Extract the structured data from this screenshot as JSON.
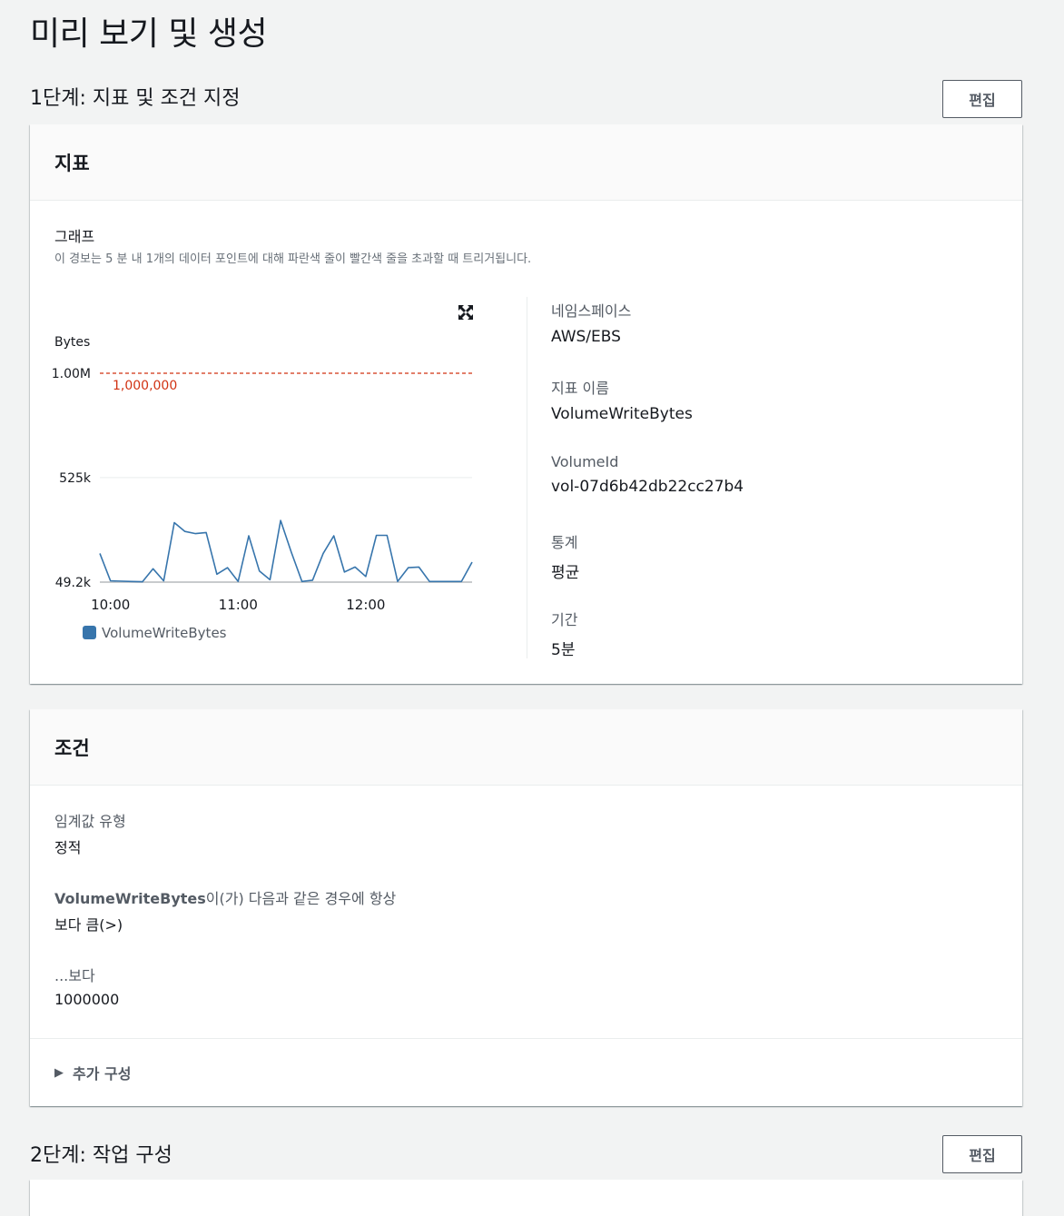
{
  "page_title": "미리 보기 및 생성",
  "step1": {
    "title": "1단계: 지표 및 조건 지정",
    "edit_label": "편집"
  },
  "metric_card": {
    "header": "지표",
    "graph_label": "그래프",
    "graph_description": "이 경보는 5 분 내 1개의 데이터 포인트에 대해 파란색 줄이 빨간색 줄을 초과할 때 트리거됩니다.",
    "expand_icon": "expand-icon",
    "details": [
      {
        "label": "네임스페이스",
        "value": "AWS/EBS"
      },
      {
        "label": "지표 이름",
        "value": "VolumeWriteBytes"
      },
      {
        "label": "VolumeId",
        "value": "vol-07d6b42db22cc27b4"
      },
      {
        "label": "통계",
        "value": "평균"
      },
      {
        "label": "기간",
        "value": "5분"
      }
    ]
  },
  "chart_data": {
    "type": "line",
    "ylabel": "Bytes",
    "y_ticks": [
      "1.00M",
      "525k",
      "49.2k"
    ],
    "y_tick_values": [
      1000000,
      525000,
      49200
    ],
    "ylim": [
      49200,
      1000000
    ],
    "x_ticks": [
      "10:00",
      "11:00",
      "12:00"
    ],
    "x_tick_minutes": [
      0,
      60,
      120
    ],
    "x_range_minutes": [
      -5,
      170
    ],
    "threshold": {
      "value": 1000000,
      "label": "1,000,000",
      "color": "#d13212"
    },
    "series": [
      {
        "name": "VolumeWriteBytes",
        "color": "#3775ac",
        "x_minutes": [
          -5,
          0,
          10,
          15,
          20,
          25,
          30,
          35,
          40,
          45,
          50,
          55,
          60,
          65,
          70,
          75,
          80,
          85,
          90,
          95,
          100,
          105,
          110,
          115,
          120,
          125,
          130,
          135,
          140,
          145,
          150,
          155,
          160,
          165,
          170
        ],
        "values": [
          180000,
          55000,
          52000,
          51000,
          110000,
          55000,
          320000,
          280000,
          270000,
          275000,
          85000,
          115000,
          52000,
          260000,
          100000,
          60000,
          330000,
          185000,
          52000,
          58000,
          180000,
          260000,
          95000,
          118000,
          75000,
          262000,
          262000,
          52000,
          115000,
          118000,
          52000,
          52000,
          52000,
          52000,
          140000
        ]
      }
    ],
    "legend": [
      "VolumeWriteBytes"
    ],
    "legend_position": "bottom-left",
    "grid": true
  },
  "conditions_card": {
    "header": "조건",
    "threshold_type_label": "임계값 유형",
    "threshold_type_value": "정적",
    "condition_metric": "VolumeWriteBytes",
    "condition_suffix": "이(가) 다음과 같은 경우에 항상",
    "condition_value": "보다 큼(>)",
    "than_label": "...보다",
    "than_value": "1000000",
    "additional_config": "추가 구성"
  },
  "step2": {
    "title": "2단계: 작업 구성",
    "edit_label": "편집"
  }
}
